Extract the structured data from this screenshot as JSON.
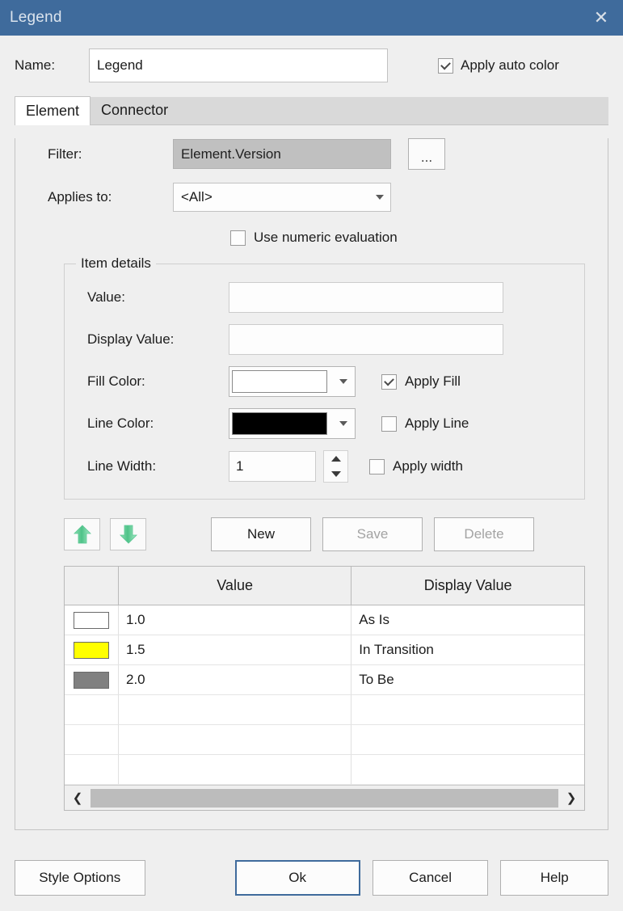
{
  "window": {
    "title": "Legend",
    "close_icon": "close-icon"
  },
  "name_row": {
    "label": "Name:",
    "value": "Legend",
    "placeholder": "",
    "apply_auto_color": {
      "label": "Apply auto color",
      "checked": true
    }
  },
  "tabs": [
    {
      "label": "Element",
      "active": true
    },
    {
      "label": "Connector",
      "active": false
    }
  ],
  "element_tab": {
    "filter": {
      "label": "Filter:",
      "value": "Element.Version",
      "browse_button_label": "..."
    },
    "applies_to": {
      "label": "Applies to:",
      "value": "<All>",
      "options": [
        "<All>"
      ]
    },
    "use_numeric_evaluation": {
      "label": "Use numeric evaluation",
      "checked": false
    },
    "item_details": {
      "title": "Item details",
      "value": {
        "label": "Value:",
        "value": "",
        "placeholder": ""
      },
      "display_value": {
        "label": "Display Value:",
        "value": "",
        "placeholder": ""
      },
      "fill_color": {
        "label": "Fill Color:",
        "color": "#ffffff",
        "apply": {
          "label": "Apply Fill",
          "checked": true
        }
      },
      "line_color": {
        "label": "Line Color:",
        "color": "#000000",
        "apply": {
          "label": "Apply Line",
          "checked": false
        }
      },
      "line_width": {
        "label": "Line Width:",
        "value": "1",
        "apply": {
          "label": "Apply width",
          "checked": false
        }
      }
    },
    "actions": {
      "move_up_icon": "arrow-up-icon",
      "move_down_icon": "arrow-down-icon",
      "new_label": "New",
      "save_label": "Save",
      "save_disabled": true,
      "delete_label": "Delete",
      "delete_disabled": true
    },
    "table": {
      "columns": [
        "",
        "Value",
        "Display Value"
      ],
      "rows": [
        {
          "color": "#ffffff",
          "value": "1.0",
          "display_value": "As Is"
        },
        {
          "color": "#ffff00",
          "value": "1.5",
          "display_value": "In Transition"
        },
        {
          "color": "#808080",
          "value": "2.0",
          "display_value": "To Be"
        }
      ],
      "empty_rows": 3,
      "scrollbar": {
        "left_icon": "chevron-left-icon",
        "right_icon": "chevron-right-icon"
      }
    }
  },
  "footer": {
    "style_options_label": "Style Options",
    "ok_label": "Ok",
    "cancel_label": "Cancel",
    "help_label": "Help"
  },
  "colors": {
    "titlebar": "#3f6b9c",
    "dialog_bg": "#efefef",
    "accent": "#3f6b9c",
    "readonly_field": "#c0c0c0",
    "arrow_green": "#57c98a"
  }
}
